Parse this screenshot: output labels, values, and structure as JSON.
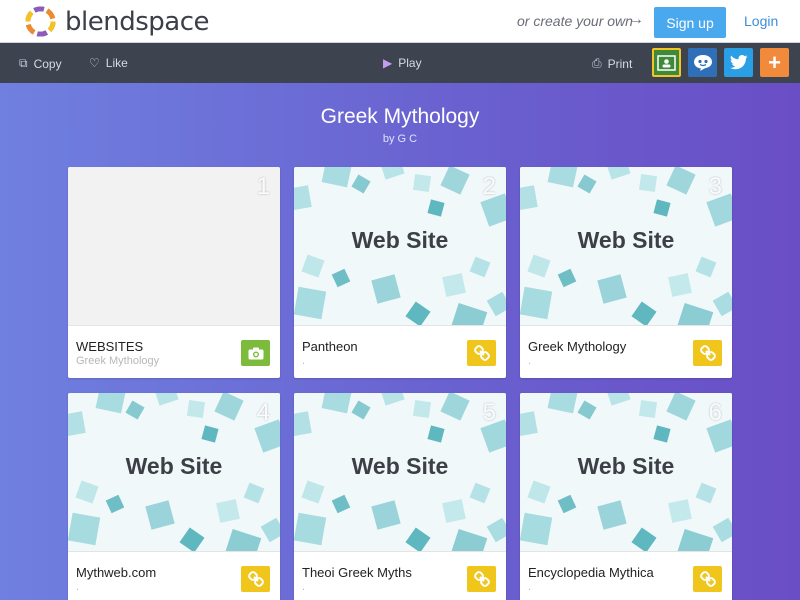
{
  "header": {
    "brand": "blendspace",
    "create_text": "or create your own",
    "signup_label": "Sign up",
    "login_label": "Login"
  },
  "toolbar": {
    "copy_label": "Copy",
    "like_label": "Like",
    "play_label": "Play",
    "print_label": "Print",
    "share_icons": [
      "google-classroom-icon",
      "remind-icon",
      "twitter-icon",
      "share-more-icon"
    ]
  },
  "lesson": {
    "title": "Greek Mythology",
    "byline": "by G C"
  },
  "thumb_text": "Web Site",
  "cards": [
    {
      "number": "1",
      "title": "WEBSITES",
      "subtitle": "Greek Mythology",
      "type": "camera"
    },
    {
      "number": "2",
      "title": "Pantheon",
      "subtitle": ".",
      "type": "link"
    },
    {
      "number": "3",
      "title": "Greek Mythology",
      "subtitle": ".",
      "type": "link"
    },
    {
      "number": "4",
      "title": "Mythweb.com",
      "subtitle": ".",
      "type": "link"
    },
    {
      "number": "5",
      "title": "Theoi Greek Myths",
      "subtitle": ".",
      "type": "link"
    },
    {
      "number": "6",
      "title": "Encyclopedia Mythica",
      "subtitle": ".",
      "type": "link"
    }
  ],
  "colors": {
    "signup": "#4aa8ee",
    "toolbar": "#3d434f",
    "camera_badge": "#7dbb3c",
    "link_badge": "#f0c61c"
  }
}
